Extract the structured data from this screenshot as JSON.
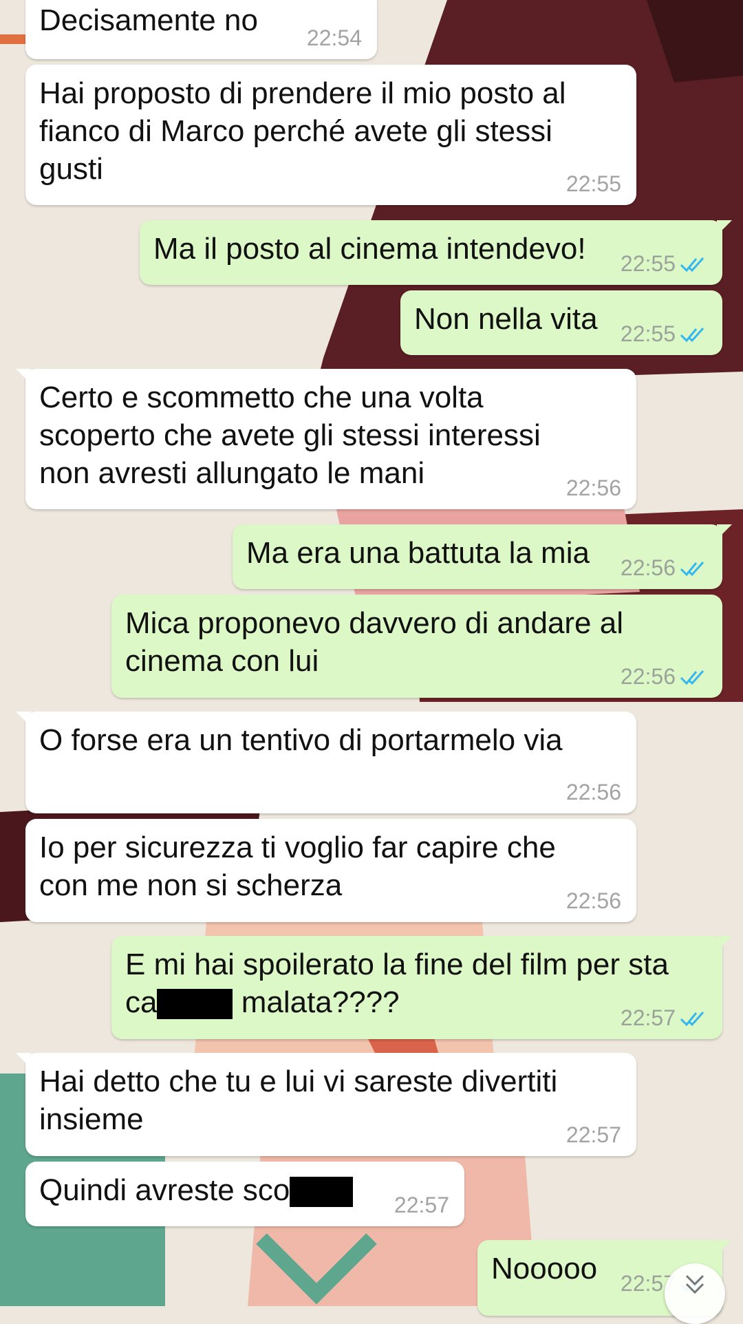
{
  "messages": [
    {
      "dir": "in",
      "text": "Decisamente no",
      "time": "22:54"
    },
    {
      "dir": "in",
      "text": "Hai proposto di prendere il mio posto al\nfianco di Marco perché avete gli stessi\ngusti",
      "time": "22:55"
    },
    {
      "dir": "out",
      "text": "Ma il posto al cinema intendevo!",
      "time": "22:55",
      "status": "read"
    },
    {
      "dir": "out",
      "text": "Non nella vita",
      "time": "22:55",
      "status": "read"
    },
    {
      "dir": "in",
      "text": "Certo e scommetto che una volta\nscoperto che avete gli stessi interessi\nnon avresti allungato le mani",
      "time": "22:56"
    },
    {
      "dir": "out",
      "text": "Ma era una battuta la mia",
      "time": "22:56",
      "status": "read"
    },
    {
      "dir": "out",
      "text": "Mica proponevo davvero di andare al\ncinema con lui",
      "time": "22:56",
      "status": "read"
    },
    {
      "dir": "in",
      "text": "O forse era un tentivo di portarmelo via",
      "time": "22:56"
    },
    {
      "dir": "in",
      "text": "Io per sicurezza ti voglio far capire che\ncon me non si scherza",
      "time": "22:56"
    },
    {
      "dir": "out",
      "text_line1": "E mi hai spoilerato la fine del film per sta",
      "text_pre": "ca",
      "text_post": " malata????",
      "time": "22:57",
      "status": "read"
    },
    {
      "dir": "in",
      "text": "Hai detto che tu e lui vi sareste divertiti\ninsieme",
      "time": "22:57"
    },
    {
      "dir": "in",
      "text_pre": "Quindi avreste sco",
      "time": "22:57"
    },
    {
      "dir": "out",
      "text": "Nooooo",
      "time": "22:57",
      "status": "read"
    }
  ],
  "colors": {
    "incoming_bubble": "#ffffff",
    "outgoing_bubble": "#dcf8c6",
    "read_ticks": "#34b7f1",
    "timestamp": "#9aa29a"
  },
  "icons": {
    "read_receipt": "double-check-icon",
    "scroll_down": "chevron-down-icon"
  }
}
